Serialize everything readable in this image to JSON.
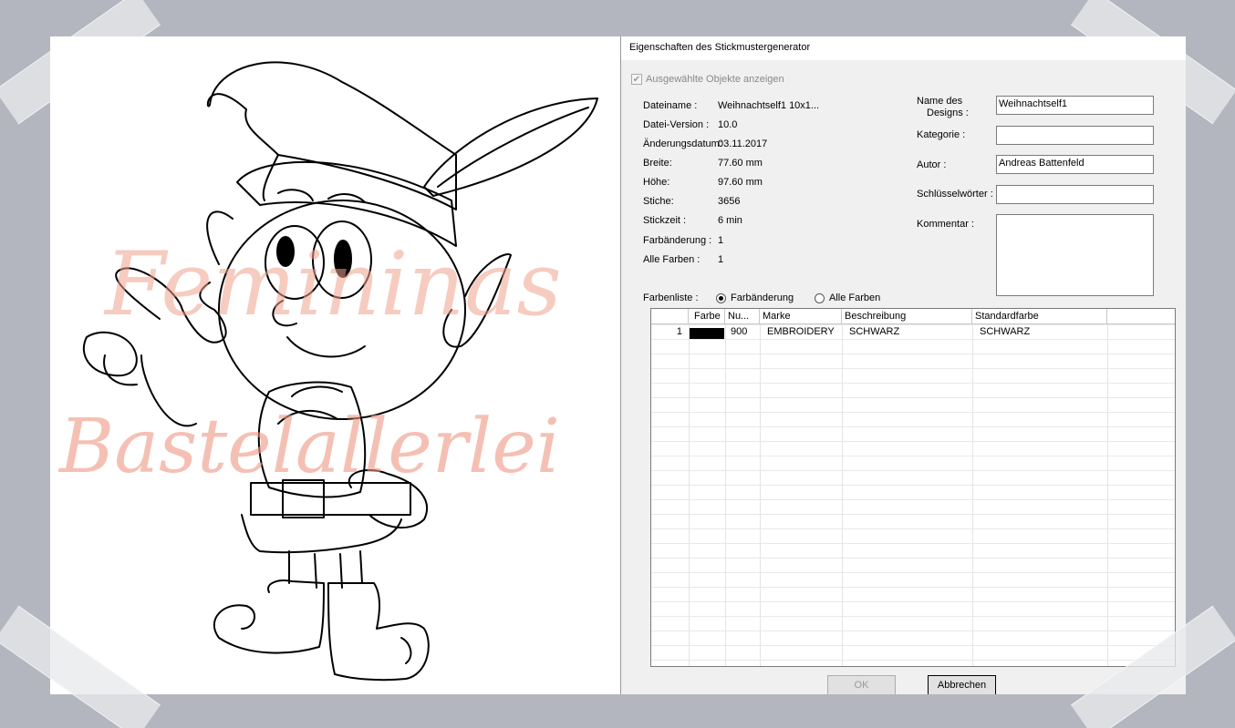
{
  "dialog": {
    "title": "Eigenschaften des Stickmustergenerator",
    "show_selected_label": "Ausgewählte Objekte anzeigen",
    "info": [
      {
        "label": "Dateiname :",
        "value": "Weihnachtself1 10x1..."
      },
      {
        "label": "Datei-Version :",
        "value": "10.0"
      },
      {
        "label": "Änderungsdatum:",
        "value": "03.11.2017"
      },
      {
        "label": "Breite:",
        "value": "77.60 mm"
      },
      {
        "label": "Höhe:",
        "value": "97.60 mm"
      },
      {
        "label": "Stiche:",
        "value": "3656"
      },
      {
        "label": "Stickzeit :",
        "value": "6 min"
      },
      {
        "label": "Farbänderung :",
        "value": "1"
      },
      {
        "label": "Alle Farben :",
        "value": "1"
      }
    ],
    "design_name_label_1": "Name des",
    "design_name_label_2": "Designs :",
    "design_name_value": "Weihnachtself1",
    "category_label": "Kategorie :",
    "category_value": "",
    "author_label": "Autor :",
    "author_value": "Andreas Battenfeld",
    "keywords_label": "Schlüsselwörter :",
    "keywords_value": "",
    "comment_label": "Kommentar :",
    "colorlist_label": "Farbenliste :",
    "radio_color_change": "Farbänderung",
    "radio_all_colors": "Alle Farben",
    "selected_radio": "Farbänderung",
    "table": {
      "headers": [
        "",
        "Farbe",
        "Nu...",
        "Marke",
        "Beschreibung",
        "Standardfarbe"
      ],
      "rows": [
        {
          "index": "1",
          "color": "#000000",
          "number": "900",
          "brand": "EMBROIDERY",
          "description": "SCHWARZ",
          "standard": "SCHWARZ"
        }
      ]
    },
    "ok_label": "OK",
    "cancel_label": "Abbrechen"
  },
  "watermark": {
    "line1": "Femininas",
    "line2": "Bastelallerlei"
  }
}
